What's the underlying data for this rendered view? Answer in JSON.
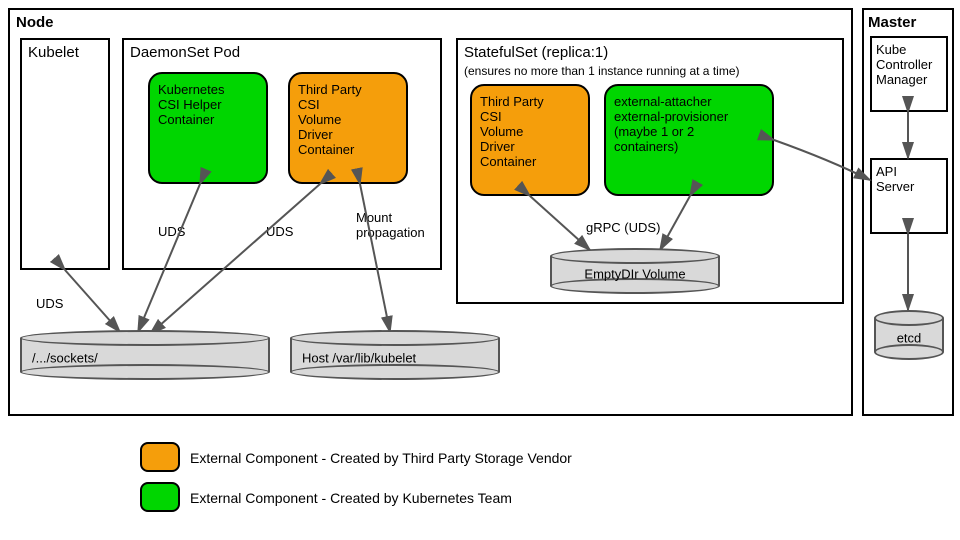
{
  "node": {
    "title": "Node",
    "kubelet": "Kubelet",
    "daemonset": {
      "title": "DaemonSet Pod",
      "helper": "Kubernetes\nCSI Helper\nContainer",
      "driver": "Third Party\nCSI\nVolume\nDriver\nContainer"
    },
    "statefulset": {
      "title": "StatefulSet (replica:1)",
      "note": "(ensures no more than 1 instance running at a time)",
      "driver": "Third Party\nCSI\nVolume\nDriver\nContainer",
      "external": "external-attacher\nexternal-provisioner\n(maybe 1 or 2\ncontainers)",
      "emptydir": "EmptyDIr Volume"
    },
    "sockets": "/.../sockets/",
    "hostpath": "Host /var/lib/kubelet"
  },
  "master": {
    "title": "Master",
    "kcm": "Kube\nController\nManager",
    "apiserver": "API\nServer",
    "etcd": "etcd"
  },
  "edges": {
    "uds1": "UDS",
    "uds2": "UDS",
    "uds3": "UDS",
    "mount": "Mount\npropagation",
    "grpc": "gRPC (UDS)"
  },
  "legend": {
    "orange": "External Component - Created by Third Party Storage Vendor",
    "green": "External Component - Created by Kubernetes Team"
  }
}
